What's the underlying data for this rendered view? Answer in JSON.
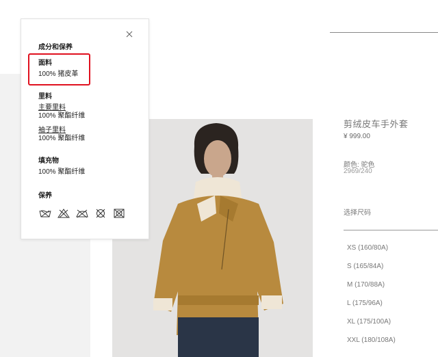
{
  "composition_panel": {
    "heading": "成分和保养",
    "fabric": {
      "title": "面料",
      "value": "100% 猪皮革"
    },
    "lining": {
      "title": "里料",
      "main_title": "主要里料",
      "main_value": "100% 聚酯纤维",
      "sleeve_title": "袖子里料",
      "sleeve_value": "100% 聚酯纤维"
    },
    "filling": {
      "title": "填充物",
      "value": "100% 聚酯纤维"
    },
    "care": {
      "title": "保养",
      "icons": [
        "wash-icon",
        "no-bleach-icon",
        "iron-icon",
        "no-dry-clean-icon",
        "no-tumble-dry-icon"
      ]
    }
  },
  "product": {
    "name": "剪绒皮车手外套",
    "price": "¥ 999.00",
    "color": "颜色: 驼色",
    "reference": "2969/240",
    "size_label": "选择尺码",
    "sizes": [
      "XS (160/80A)",
      "S (165/84A)",
      "M (170/88A)",
      "L (175/96A)",
      "XL (175/100A)",
      "XXL (180/108A)"
    ]
  },
  "colors": {
    "highlight": "#e0101e",
    "jacket": "#b88a3e",
    "shearling": "#efe6d6"
  }
}
